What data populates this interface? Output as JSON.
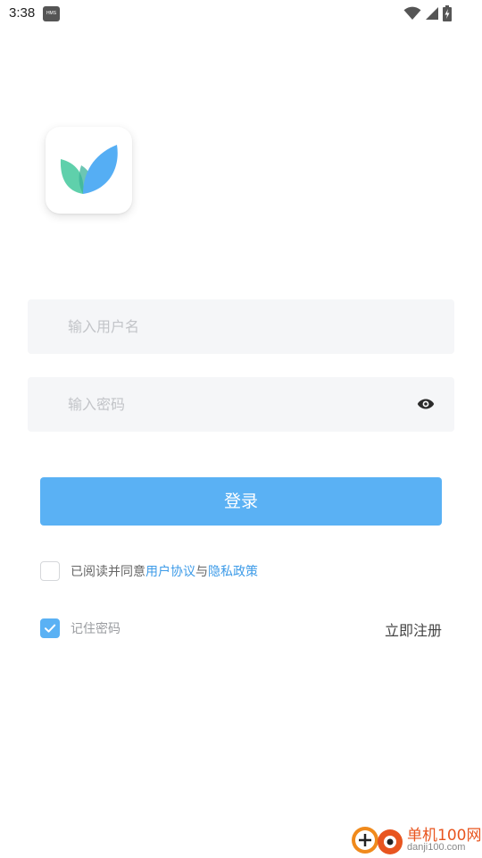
{
  "status_bar": {
    "time": "3:38",
    "badge": "HMS",
    "icons": [
      "wifi-icon",
      "signal-icon",
      "battery-charging-icon"
    ]
  },
  "app": {
    "logo_icon": "leaf-logo-icon",
    "colors": {
      "accent": "#5ab1f4",
      "link": "#3d9be8",
      "input_bg": "#f5f6f8",
      "leaf_green": "#5fd0ab",
      "leaf_blue": "#55aef4"
    }
  },
  "form": {
    "username_placeholder": "输入用户名",
    "password_placeholder": "输入密码",
    "password_toggle_icon": "eye-icon",
    "login_label": "登录"
  },
  "agreement": {
    "checked": false,
    "prefix": "已阅读并同意",
    "user_agreement": "用户协议",
    "joiner": "与",
    "privacy_policy": "隐私政策"
  },
  "remember": {
    "checked": true,
    "label": "记住密码"
  },
  "register": {
    "label": "立即注册"
  },
  "watermark": {
    "title": "单机100网",
    "url": "danji100.com"
  }
}
